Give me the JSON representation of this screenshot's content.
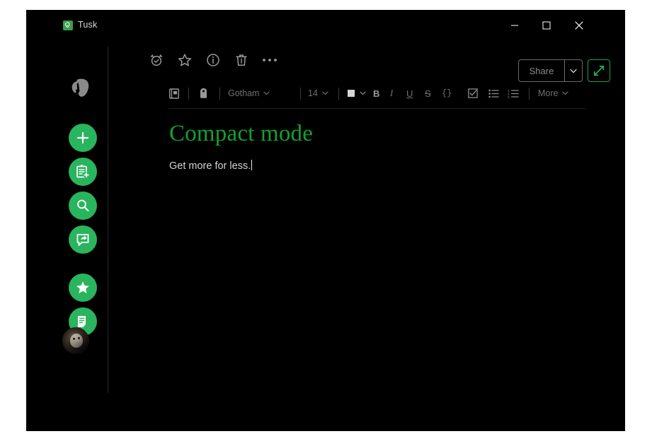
{
  "window": {
    "app_title": "Tusk",
    "app_icon": "evernote-elephant-icon",
    "controls": {
      "minimize": "minimize-icon",
      "maximize": "maximize-icon",
      "close": "close-icon"
    }
  },
  "sidebar": {
    "brand_icon": "elephant-logo",
    "items": [
      {
        "name": "new-note",
        "icon": "plus-icon"
      },
      {
        "name": "new-task",
        "icon": "note-plus-icon"
      },
      {
        "name": "search",
        "icon": "magnifier-icon"
      },
      {
        "name": "web-clipper",
        "icon": "clip-share-icon"
      },
      {
        "name": "shortcuts",
        "icon": "star-icon"
      },
      {
        "name": "notes",
        "icon": "document-icon"
      }
    ],
    "avatar": "user-avatar"
  },
  "note_toolbar": {
    "items": [
      {
        "name": "reminder",
        "icon": "alarm-clock-icon"
      },
      {
        "name": "favorite",
        "icon": "star-outline-icon"
      },
      {
        "name": "info",
        "icon": "info-circle-icon"
      },
      {
        "name": "delete",
        "icon": "trash-icon"
      },
      {
        "name": "more-options",
        "icon": "ellipsis-icon"
      }
    ],
    "share_label": "Share",
    "share_caret": "chevron-down-icon",
    "expand_icon": "expand-arrows-icon"
  },
  "format_bar": {
    "notebook_icon": "notebook-icon",
    "tag_icon": "tag-icon",
    "font_family": "Gotham",
    "font_size": "14",
    "color_swatch": "#d6d6d6",
    "bold": "B",
    "italic": "I",
    "underline": "U",
    "strikethrough": "S",
    "code": "{}",
    "todo_icon": "checkbox-icon",
    "bulleted_list_icon": "bulleted-list-icon",
    "numbered_list_icon": "numbered-list-icon",
    "more_label": "More",
    "more_caret": "chevron-down-icon"
  },
  "note": {
    "title": "Compact mode",
    "body": "Get more for less."
  },
  "colors": {
    "accent_green": "#29b45e",
    "title_green": "#12a12f",
    "expand_border": "#1f9d4d",
    "window_bg": "#000000",
    "page_bg": "#ffffff"
  }
}
